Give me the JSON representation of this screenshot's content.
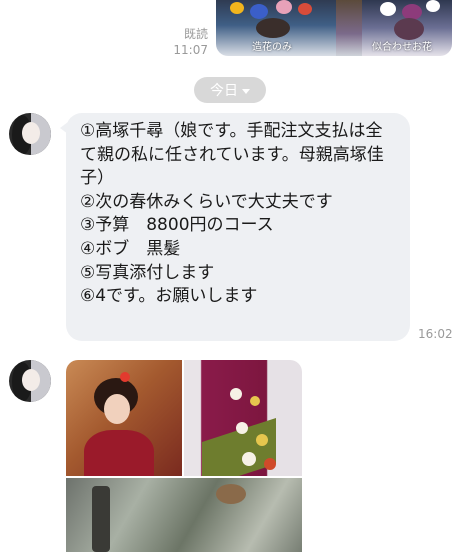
{
  "top_message": {
    "read_label": "既読",
    "time": "11:07",
    "image_captions": [
      "造花のみ",
      "似合わせお花"
    ]
  },
  "date_chip": {
    "label": "今日"
  },
  "incoming_message": {
    "lines": [
      "①高塚千尋（娘です。手配注文支払は全",
      "て親の私に任されています。母親高塚佳",
      "子）",
      "②次の春休みくらいで大丈夫です",
      "③予算　8800円のコース",
      "④ボブ　黒髪",
      "⑤写真添付します",
      "⑥4です。お願いします"
    ],
    "time": "16:02"
  },
  "colors": {
    "bubble": "#eef0f3",
    "date_chip": "#d8d8d8",
    "meta_text": "#9a9a9a"
  }
}
